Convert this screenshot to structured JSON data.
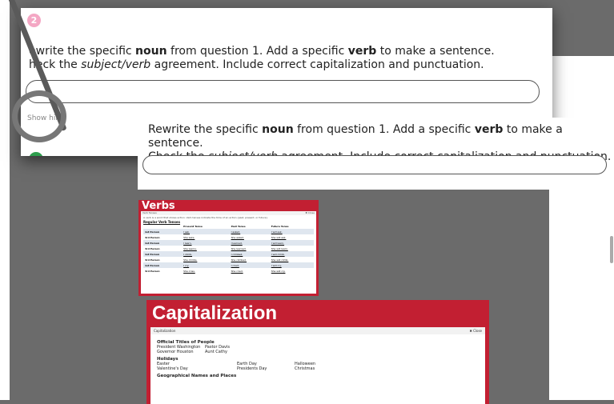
{
  "question": {
    "number": "2",
    "prompt_line1_pre": "Rewrite the specific ",
    "prompt_noun": "noun",
    "prompt_line1_mid": " from question 1. Add a specific ",
    "prompt_verb": "verb",
    "prompt_line1_post": " to make a sentence.",
    "prompt_line2_pre": "Check the ",
    "prompt_line2_italic": "subject/verb",
    "prompt_line2_post": " agreement. Include correct capitalization and punctuation.",
    "back_prompt_line1_pre": "ewrite the specific ",
    "back_prompt_line2_pre": "heck the ",
    "hint_label": "Show hint"
  },
  "verbs": {
    "title": "Verbs",
    "panel_label": "Verb Tenses",
    "close": "✖ Close",
    "description": "A verb is a word that shows action. Verb tenses indicate the time of an action (past, present, or future).",
    "subheading": "Regular Verb Tenses",
    "headers": [
      "",
      "Present Tense",
      "Past Tense",
      "Future Tense"
    ],
    "rows": [
      [
        "1st Person",
        "I ask.",
        "I asked.",
        "I will ask."
      ],
      [
        "3rd Person",
        "She asks.",
        "She asked.",
        "She will ask."
      ],
      [
        "1st Person",
        "I learn.",
        "I learned.",
        "I will learn."
      ],
      [
        "3rd Person",
        "She learns.",
        "She learned.",
        "She will learn."
      ],
      [
        "1st Person",
        "I climb.",
        "I climbed.",
        "I will climb."
      ],
      [
        "3rd Person",
        "She climbs.",
        "She climbed.",
        "She will climb."
      ],
      [
        "1st Person",
        "I cry.",
        "I cried.",
        "I will cry."
      ],
      [
        "3rd Person",
        "She cries.",
        "She cried.",
        "She will cry."
      ]
    ]
  },
  "capitalization": {
    "title": "Capitalization",
    "panel_label": "Capitalization",
    "close": "✖ Close",
    "sections": [
      {
        "heading": "Official Titles of People",
        "rows": [
          [
            "President Washington",
            "Pastor Davis"
          ],
          [
            "Governor Houston",
            "Aunt Cathy"
          ]
        ]
      },
      {
        "heading": "Holidays",
        "rows": [
          [
            "Easter",
            "Earth Day",
            "Halloween"
          ],
          [
            "Valentine's Day",
            "Presidents Day",
            "Christmas"
          ]
        ]
      },
      {
        "heading": "Geographical Names and Places",
        "rows": []
      }
    ]
  },
  "colors": {
    "accent_red": "#c21f32",
    "question_badge": "#f4a7c4",
    "next_badge": "#2e9e4d"
  }
}
